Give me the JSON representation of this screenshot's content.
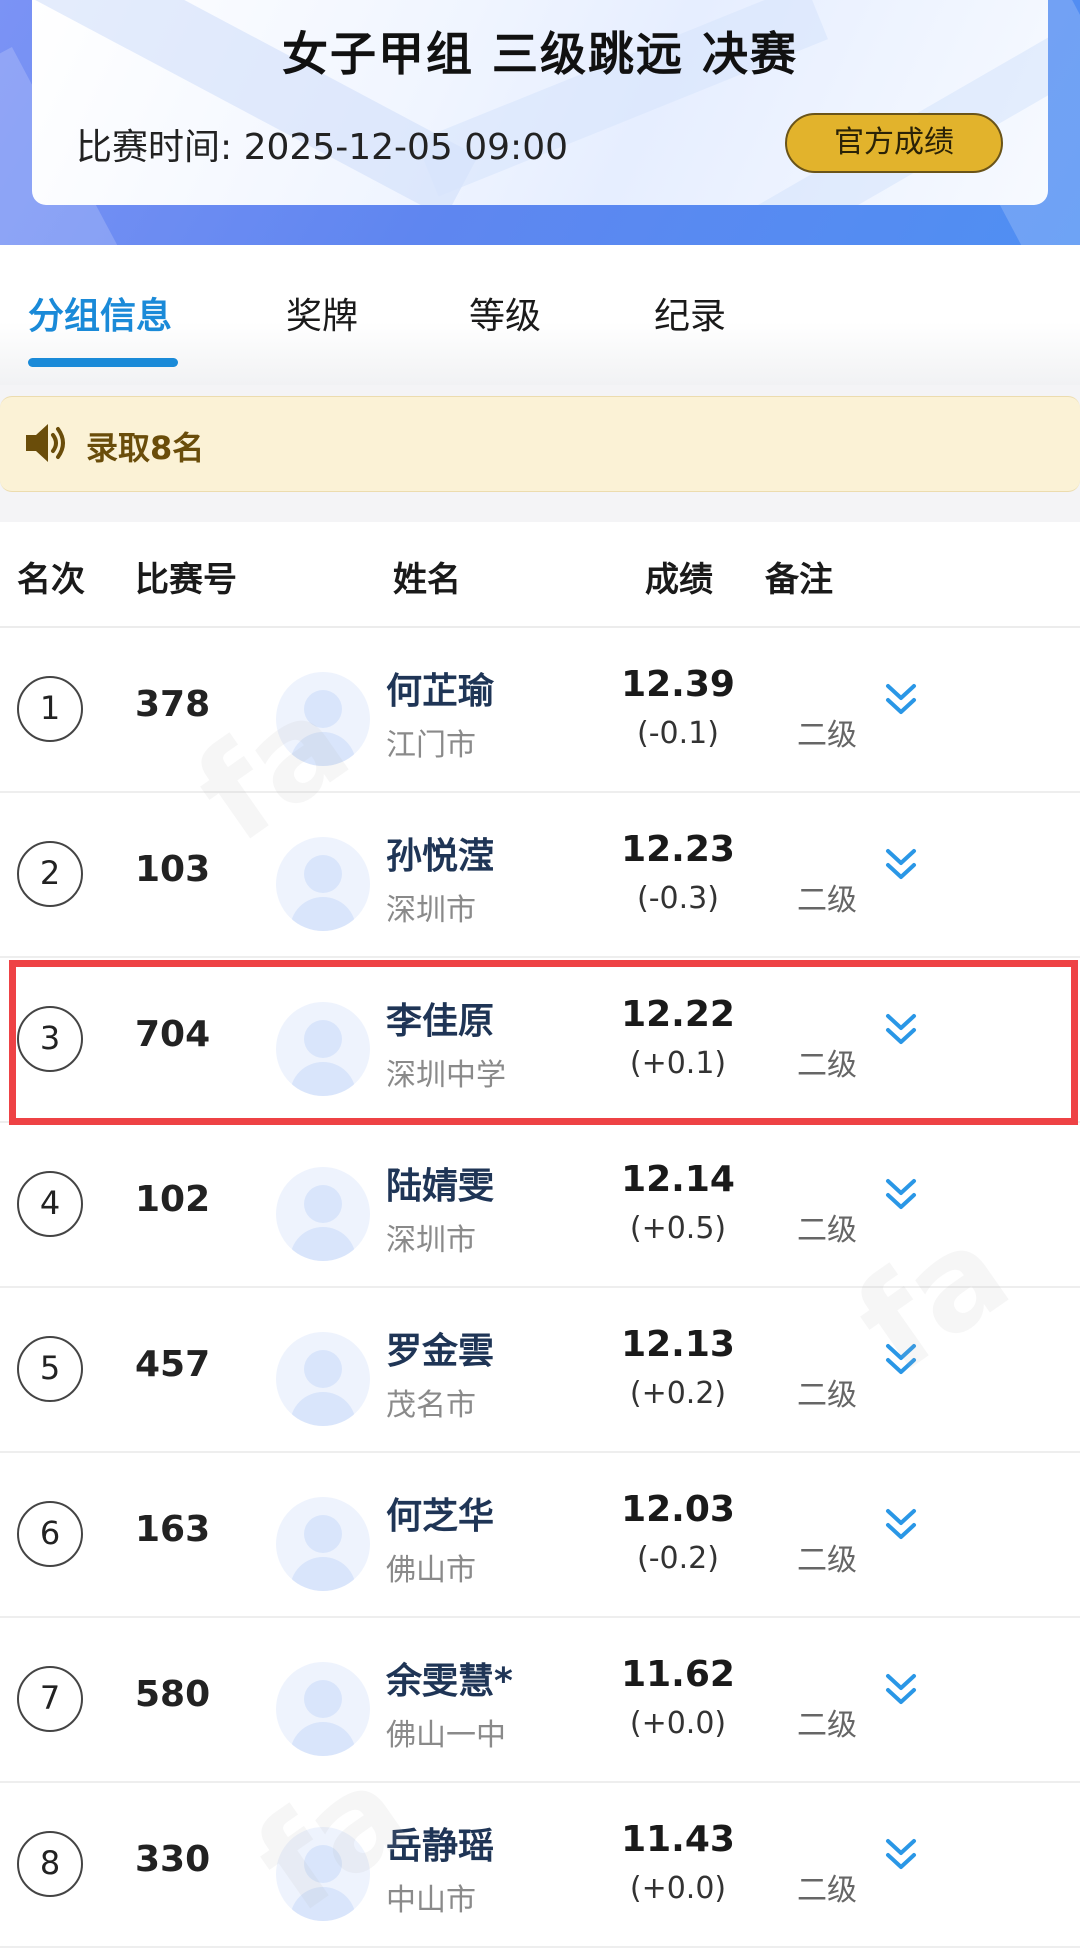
{
  "header": {
    "title": "女子甲组 三级跳远 决赛",
    "time_label": "比赛时间:",
    "time_value": "2025-12-05  09:00",
    "official_button": "官方成绩"
  },
  "tabs": [
    {
      "label": "分组信息",
      "active": true
    },
    {
      "label": "奖牌",
      "active": false
    },
    {
      "label": "等级",
      "active": false
    },
    {
      "label": "纪录",
      "active": false
    }
  ],
  "notice": {
    "text": "录取8名",
    "icon": "speaker-icon"
  },
  "table": {
    "headers": {
      "rank": "名次",
      "bib": "比赛号",
      "name": "姓名",
      "mark": "成绩",
      "note": "备注"
    },
    "rows": [
      {
        "rank": "1",
        "bib": "378",
        "name": "何芷瑜",
        "club": "江门市",
        "mark": "12.39",
        "wind": "(-0.1)",
        "grade": "二级"
      },
      {
        "rank": "2",
        "bib": "103",
        "name": "孙悦滢",
        "club": "深圳市",
        "mark": "12.23",
        "wind": "(-0.3)",
        "grade": "二级"
      },
      {
        "rank": "3",
        "bib": "704",
        "name": "李佳原",
        "club": "深圳中学",
        "mark": "12.22",
        "wind": "(+0.1)",
        "grade": "二级",
        "highlighted": true
      },
      {
        "rank": "4",
        "bib": "102",
        "name": "陆婧雯",
        "club": "深圳市",
        "mark": "12.14",
        "wind": "(+0.5)",
        "grade": "二级"
      },
      {
        "rank": "5",
        "bib": "457",
        "name": "罗金雲",
        "club": "茂名市",
        "mark": "12.13",
        "wind": "(+0.2)",
        "grade": "二级"
      },
      {
        "rank": "6",
        "bib": "163",
        "name": "何芝华",
        "club": "佛山市",
        "mark": "12.03",
        "wind": "(-0.2)",
        "grade": "二级"
      },
      {
        "rank": "7",
        "bib": "580",
        "name": "余雯慧*",
        "club": "佛山一中",
        "mark": "11.62",
        "wind": "(+0.0)",
        "grade": "二级"
      },
      {
        "rank": "8",
        "bib": "330",
        "name": "岳静瑶",
        "club": "中山市",
        "mark": "11.43",
        "wind": "(+0.0)",
        "grade": "二级"
      }
    ]
  },
  "colors": {
    "accent": "#1a8ad8",
    "button": "#e2b32c",
    "highlight": "#ee4245",
    "notice_bg": "#fbf2d6"
  }
}
